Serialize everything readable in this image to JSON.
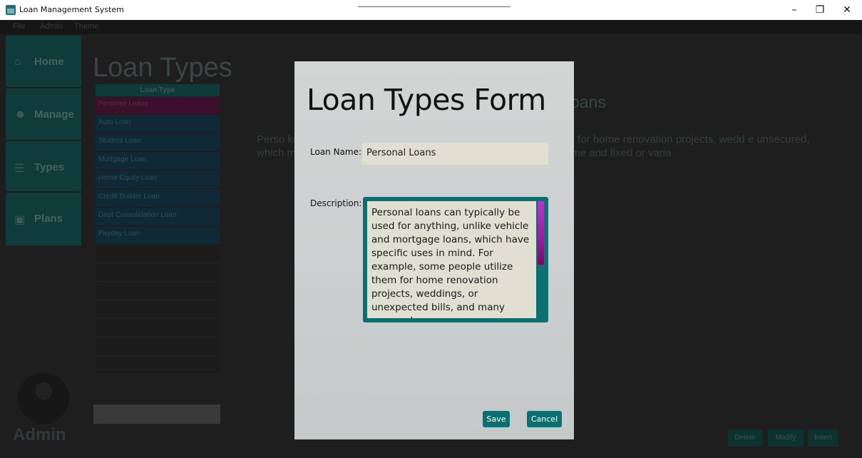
{
  "window": {
    "title": "Loan Management System",
    "minimize": "–",
    "maximize": "❐",
    "close": "✕"
  },
  "menu": [
    "File",
    "Admin",
    "Theme"
  ],
  "sidebar": {
    "items": [
      {
        "label": "Home",
        "icon": "home-icon"
      },
      {
        "label": "Manage",
        "icon": "users-icon"
      },
      {
        "label": "Types",
        "icon": "list-icon"
      },
      {
        "label": "Plans",
        "icon": "money-icon"
      }
    ],
    "user": "Admin"
  },
  "main": {
    "title": "Loan Types",
    "list_header": "Loan Type",
    "loan_types": [
      "Personal Loans",
      "Auto Loan",
      "Student Loan",
      "Mortgage Loan",
      "Home Equity Loan",
      "Credit Builder Loan",
      "Dept Consolidation Loan",
      "Payday Loan"
    ],
    "detail_heading": "oans",
    "detail_text": "Perso                                                                                      ke vehicle and mortgage loans, which have spec                                                                                 utilize them for home renovation projects, wedd                                                                              e unsecured, which means they don't call for any k                                                                           several years of repayment time and fixed or varia",
    "buttons": {
      "delete": "Delete",
      "modify": "Modify",
      "insert": "Insert"
    }
  },
  "modal": {
    "title": "Loan Types Form",
    "name_label": "Loan Name:",
    "name_value": "Personal Loans",
    "description_label": "Description:",
    "description_value": "Personal loans can typically be used for anything, unlike vehicle and mortgage loans, which have specific uses in mind. For example, some people utilize them for home renovation projects, weddings, or unexpected bills, and many personal",
    "save": "Save",
    "cancel": "Cancel"
  },
  "colors": {
    "accent": "#0c7070",
    "scroll": "#9a1c9e",
    "selected_row": "#3d0f2c"
  }
}
